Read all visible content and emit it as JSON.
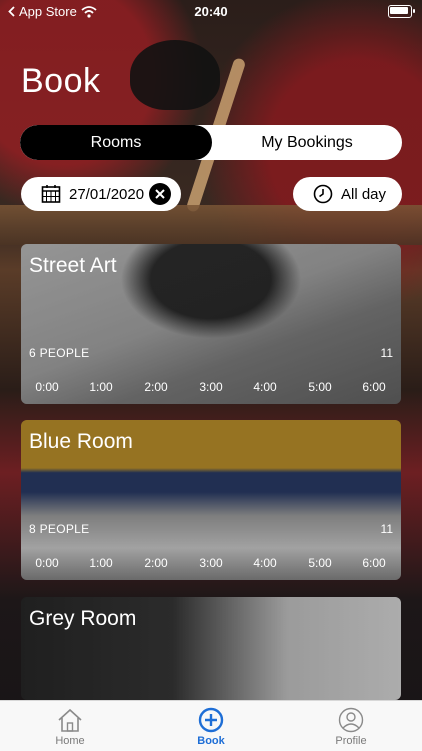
{
  "status": {
    "back_label": "App Store",
    "time": "20:40"
  },
  "page": {
    "title": "Book"
  },
  "segment": {
    "rooms_label": "Rooms",
    "bookings_label": "My Bookings"
  },
  "filters": {
    "date": "27/01/2020",
    "time_range": "All day"
  },
  "rooms": [
    {
      "name": "Street Art",
      "capacity": "6 PEOPLE",
      "count": "11",
      "times": [
        "0:00",
        "1:00",
        "2:00",
        "3:00",
        "4:00",
        "5:00",
        "6:00"
      ]
    },
    {
      "name": "Blue Room",
      "capacity": "8 PEOPLE",
      "count": "11",
      "times": [
        "0:00",
        "1:00",
        "2:00",
        "3:00",
        "4:00",
        "5:00",
        "6:00"
      ]
    },
    {
      "name": "Grey Room"
    }
  ],
  "tabs": {
    "home": "Home",
    "book": "Book",
    "profile": "Profile"
  },
  "colors": {
    "accent": "#1e6ed6",
    "tab_inactive": "#7a7a7a"
  }
}
